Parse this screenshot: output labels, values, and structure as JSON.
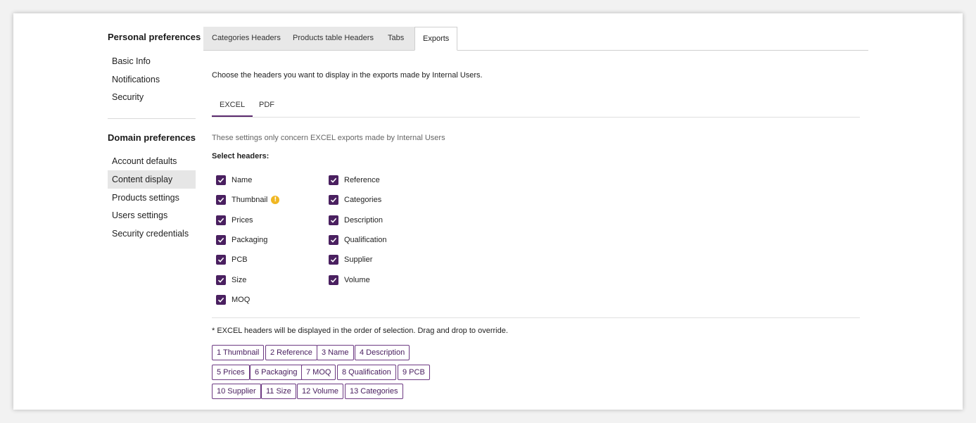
{
  "sidebar": {
    "personal_heading": "Personal preferences",
    "personal_items": [
      {
        "label": "Basic Info"
      },
      {
        "label": "Notifications"
      },
      {
        "label": "Security"
      }
    ],
    "domain_heading": "Domain preferences",
    "domain_items": [
      {
        "label": "Account defaults"
      },
      {
        "label": "Content display",
        "active": true
      },
      {
        "label": "Products settings"
      },
      {
        "label": "Users settings"
      },
      {
        "label": "Security credentials"
      }
    ]
  },
  "tabs": [
    {
      "label": "Categories Headers"
    },
    {
      "label": "Products table Headers"
    },
    {
      "label": "Tabs"
    },
    {
      "label": "Exports",
      "active": true
    }
  ],
  "intro_text": "Choose the headers you want to display in the exports made by Internal Users.",
  "sub_tabs": [
    {
      "label": "EXCEL",
      "active": true
    },
    {
      "label": "PDF"
    }
  ],
  "note_text": "These settings only concern EXCEL exports made by Internal Users",
  "select_label": "Select headers:",
  "checkboxes_left": [
    {
      "label": "Name",
      "checked": true
    },
    {
      "label": "Thumbnail",
      "checked": true,
      "icon": "warning-icon"
    },
    {
      "label": "Prices",
      "checked": true
    },
    {
      "label": "Packaging",
      "checked": true
    },
    {
      "label": "PCB",
      "checked": true
    },
    {
      "label": "Size",
      "checked": true
    },
    {
      "label": "MOQ",
      "checked": true
    }
  ],
  "checkboxes_right": [
    {
      "label": "Reference",
      "checked": true
    },
    {
      "label": "Categories",
      "checked": true
    },
    {
      "label": "Description",
      "checked": true
    },
    {
      "label": "Qualification",
      "checked": true
    },
    {
      "label": "Supplier",
      "checked": true
    },
    {
      "label": "Volume",
      "checked": true
    }
  ],
  "order_note": "* EXCEL headers will be displayed in the order of selection. Drag and drop to override.",
  "order_chips": [
    [
      "1 Thumbnail",
      "2 Reference",
      "3 Name",
      "4 Description"
    ],
    [
      "5 Prices",
      "6 Packaging",
      "7 MOQ",
      "8 Qualification",
      "9 PCB"
    ],
    [
      "10 Supplier",
      "11 Size",
      "12 Volume",
      "13 Categories"
    ]
  ],
  "colors": {
    "accent": "#4a2060",
    "warning": "#f0b722",
    "active_bg": "#e6e6e6"
  }
}
